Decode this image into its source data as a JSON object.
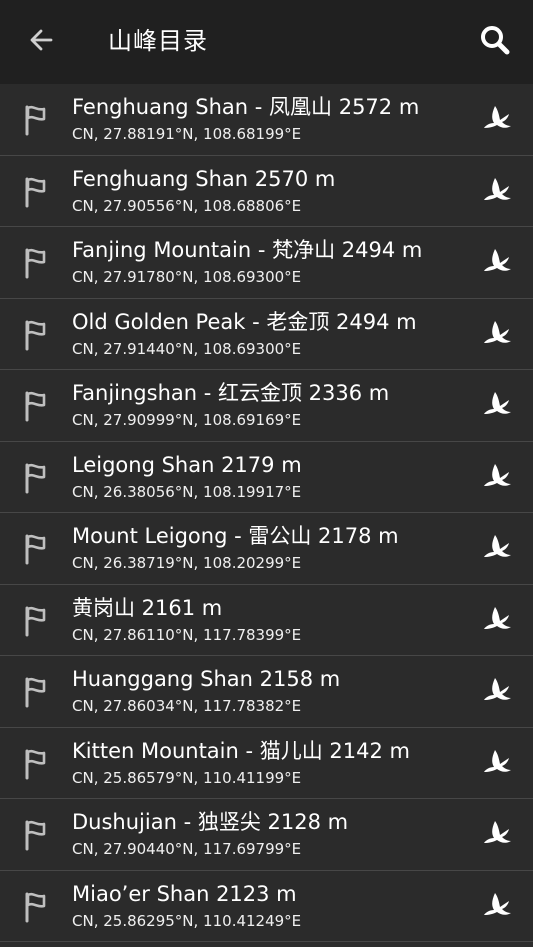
{
  "toolbar": {
    "title": "山峰目录",
    "back_icon": "arrow-left-icon",
    "search_icon": "search-icon"
  },
  "colors": {
    "toolbar_bg": "#202020",
    "list_bg": "#2b2b2b",
    "divider": "#474747",
    "text": "#ffffff"
  },
  "peaks": [
    {
      "name": "Fenghuang Shan - 凤凰山 2572 m",
      "coords": "CN, 27.88191°N, 108.68199°E"
    },
    {
      "name": "Fenghuang Shan 2570 m",
      "coords": "CN, 27.90556°N, 108.68806°E"
    },
    {
      "name": "Fanjing Mountain - 梵净山 2494 m",
      "coords": "CN, 27.91780°N, 108.69300°E"
    },
    {
      "name": "Old Golden Peak - 老金顶 2494 m",
      "coords": "CN, 27.91440°N, 108.69300°E"
    },
    {
      "name": "Fanjingshan - 红云金顶 2336 m",
      "coords": "CN, 27.90999°N, 108.69169°E"
    },
    {
      "name": "Leigong Shan 2179 m",
      "coords": "CN, 26.38056°N, 108.19917°E"
    },
    {
      "name": "Mount Leigong - 雷公山 2178 m",
      "coords": "CN, 26.38719°N, 108.20299°E"
    },
    {
      "name": "黄岗山 2161 m",
      "coords": "CN, 27.86110°N, 117.78399°E"
    },
    {
      "name": "Huanggang Shan 2158 m",
      "coords": "CN, 27.86034°N, 117.78382°E"
    },
    {
      "name": "Kitten Mountain - 猫儿山 2142 m",
      "coords": "CN, 25.86579°N, 110.41199°E"
    },
    {
      "name": "Dushujian - 独竖尖 2128 m",
      "coords": "CN, 27.90440°N, 117.69799°E"
    },
    {
      "name": "Miao’er Shan 2123 m",
      "coords": "CN, 25.86295°N, 110.41249°E"
    }
  ]
}
